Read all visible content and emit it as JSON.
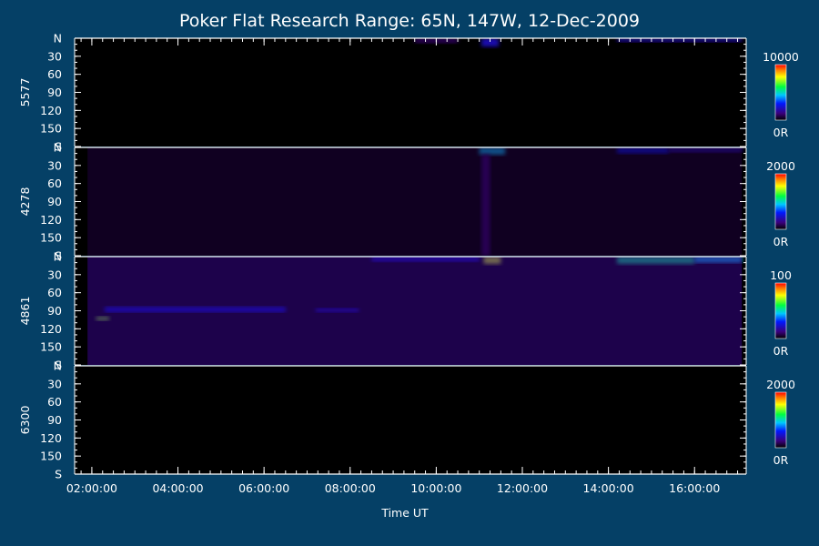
{
  "chart_data": {
    "type": "heatmap",
    "title": "Poker Flat Research Range: 65N, 147W, 12-Dec-2009",
    "xlabel": "Time UT",
    "x_ticks": [
      "02:00:00",
      "04:00:00",
      "06:00:00",
      "08:00:00",
      "10:00:00",
      "12:00:00",
      "14:00:00",
      "16:00:00"
    ],
    "x_range_hours": [
      1.6,
      17.2
    ],
    "y_ticks": [
      "N",
      "30",
      "60",
      "90",
      "120",
      "150",
      "S"
    ],
    "y_range": [
      0,
      180
    ],
    "panels": [
      {
        "name": "5577",
        "colorbar_max": "10000",
        "colorbar_min": "0R",
        "features": [
          {
            "t0": 9.5,
            "t1": 10.5,
            "z0": 0,
            "z1": 8,
            "intensity": 0.1
          },
          {
            "t0": 11.05,
            "t1": 11.45,
            "z0": 0,
            "z1": 14,
            "intensity": 0.22
          },
          {
            "t0": 14.2,
            "t1": 17.1,
            "z0": 0,
            "z1": 6,
            "intensity": 0.2
          }
        ]
      },
      {
        "name": "4278",
        "colorbar_max": "2000",
        "colorbar_min": "0R",
        "features": [
          {
            "t0": 11.0,
            "t1": 11.6,
            "z0": 0,
            "z1": 12,
            "intensity": 0.45
          },
          {
            "t0": 11.05,
            "t1": 11.25,
            "z0": 12,
            "z1": 180,
            "intensity": 0.12
          },
          {
            "t0": 14.2,
            "t1": 15.4,
            "z0": 0,
            "z1": 10,
            "intensity": 0.28
          },
          {
            "t0": 15.4,
            "t1": 17.1,
            "z0": 0,
            "z1": 8,
            "intensity": 0.2
          },
          {
            "t0": 1.9,
            "t1": 17.1,
            "z0": 0,
            "z1": 180,
            "intensity": 0.06
          }
        ]
      },
      {
        "name": "4861",
        "colorbar_max": "100",
        "colorbar_min": "0R",
        "features": [
          {
            "t0": 11.1,
            "t1": 11.5,
            "z0": 0,
            "z1": 12,
            "intensity": 0.75
          },
          {
            "t0": 14.2,
            "t1": 16.0,
            "z0": 0,
            "z1": 12,
            "intensity": 0.55
          },
          {
            "t0": 16.0,
            "t1": 17.1,
            "z0": 0,
            "z1": 10,
            "intensity": 0.45
          },
          {
            "t0": 2.1,
            "t1": 2.4,
            "z0": 100,
            "z1": 106,
            "intensity": 0.7
          },
          {
            "t0": 2.3,
            "t1": 6.5,
            "z0": 84,
            "z1": 92,
            "intensity": 0.3
          },
          {
            "t0": 7.2,
            "t1": 8.2,
            "z0": 86,
            "z1": 92,
            "intensity": 0.25
          },
          {
            "t0": 8.5,
            "t1": 11.0,
            "z0": 0,
            "z1": 8,
            "intensity": 0.25
          },
          {
            "t0": 1.9,
            "t1": 17.1,
            "z0": 0,
            "z1": 180,
            "intensity": 0.14
          }
        ]
      },
      {
        "name": "6300",
        "colorbar_max": "2000",
        "colorbar_min": "0R",
        "features": []
      }
    ]
  }
}
